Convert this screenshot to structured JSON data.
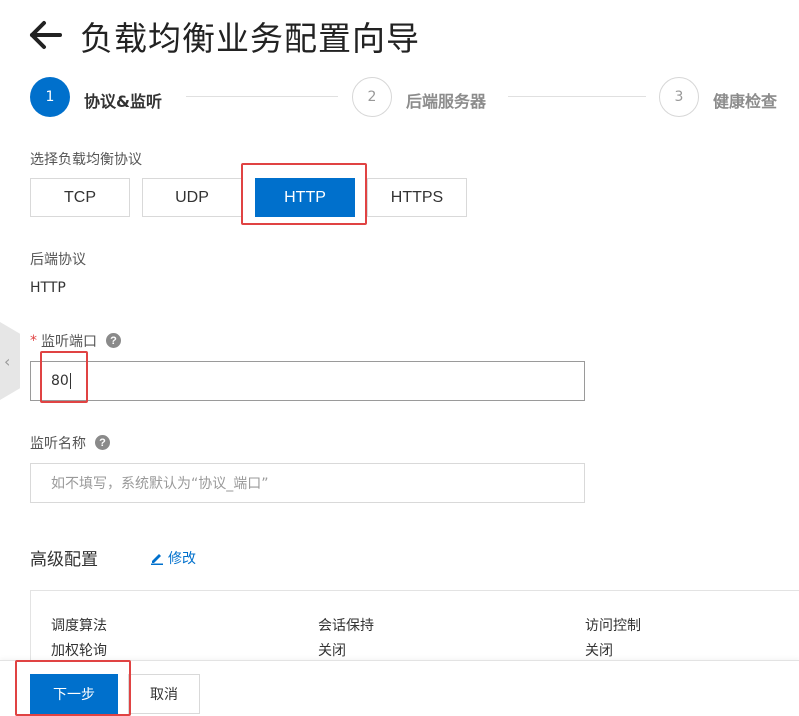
{
  "header": {
    "title": "负载均衡业务配置向导"
  },
  "steps": [
    {
      "number": "1",
      "label": "协议&监听"
    },
    {
      "number": "2",
      "label": "后端服务器"
    },
    {
      "number": "3",
      "label": "健康检查"
    }
  ],
  "protocol": {
    "label": "选择负载均衡协议",
    "options": [
      "TCP",
      "UDP",
      "HTTP",
      "HTTPS"
    ],
    "selected": "HTTP"
  },
  "backend": {
    "label": "后端协议",
    "value": "HTTP"
  },
  "port": {
    "required_mark": "*",
    "label": "监听端口",
    "value": "80"
  },
  "listener_name": {
    "label": "监听名称",
    "placeholder": "如不填写，系统默认为“协议_端口”"
  },
  "advanced": {
    "title": "高级配置",
    "edit_label": "修改",
    "items": [
      {
        "label": "调度算法",
        "value": "加权轮询"
      },
      {
        "label": "会话保持",
        "value": "关闭"
      },
      {
        "label": "访问控制",
        "value": "关闭"
      }
    ]
  },
  "footer": {
    "next_label": "下一步",
    "cancel_label": "取消"
  },
  "colors": {
    "primary": "#0070cc",
    "highlight": "#e04343"
  },
  "icons": {
    "back": "arrow-left-icon",
    "help": "question-circle-icon",
    "edit": "pencil-icon",
    "collapse": "chevron-left-icon"
  }
}
